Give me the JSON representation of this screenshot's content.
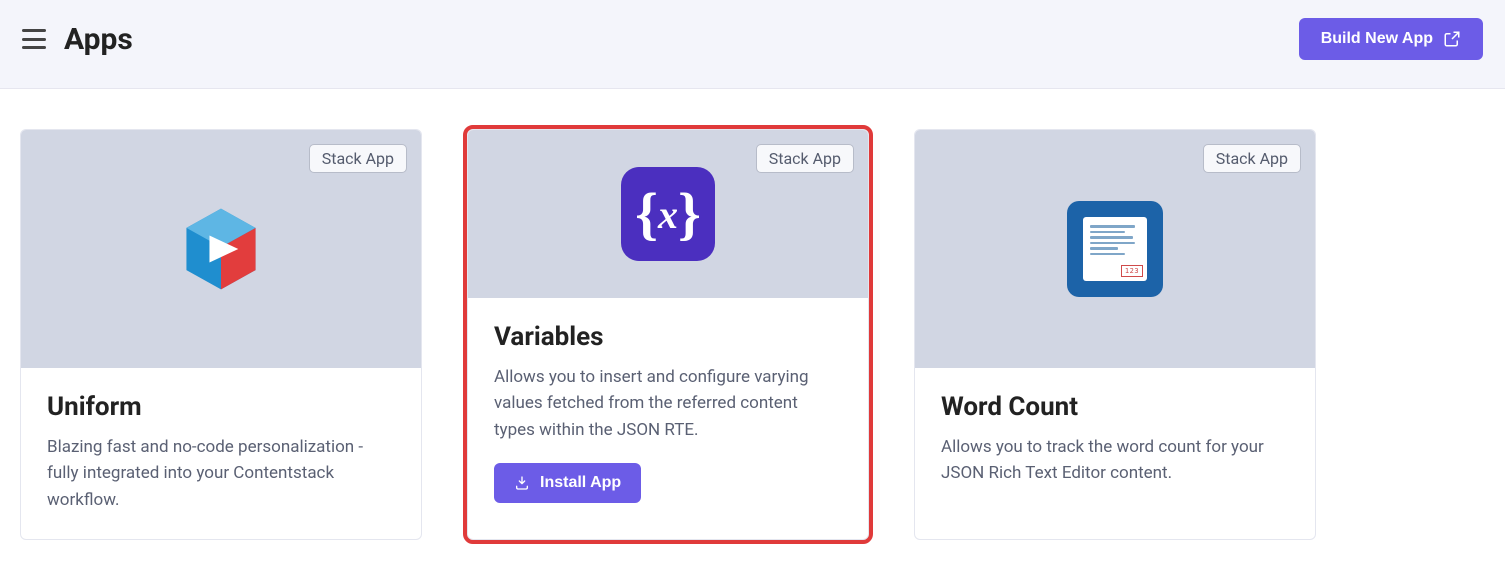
{
  "header": {
    "title": "Apps",
    "build_button": "Build New App"
  },
  "badge_label": "Stack App",
  "install_label": "Install App",
  "cards": [
    {
      "title": "Uniform",
      "description": "Blazing fast and no-code personalization - fully integrated into your Contentstack workflow."
    },
    {
      "title": "Variables",
      "description": "Allows you to insert and configure varying values fetched from the referred content types within the JSON RTE."
    },
    {
      "title": "Word Count",
      "description": "Allows you to track the word count for your JSON Rich Text Editor content."
    }
  ]
}
